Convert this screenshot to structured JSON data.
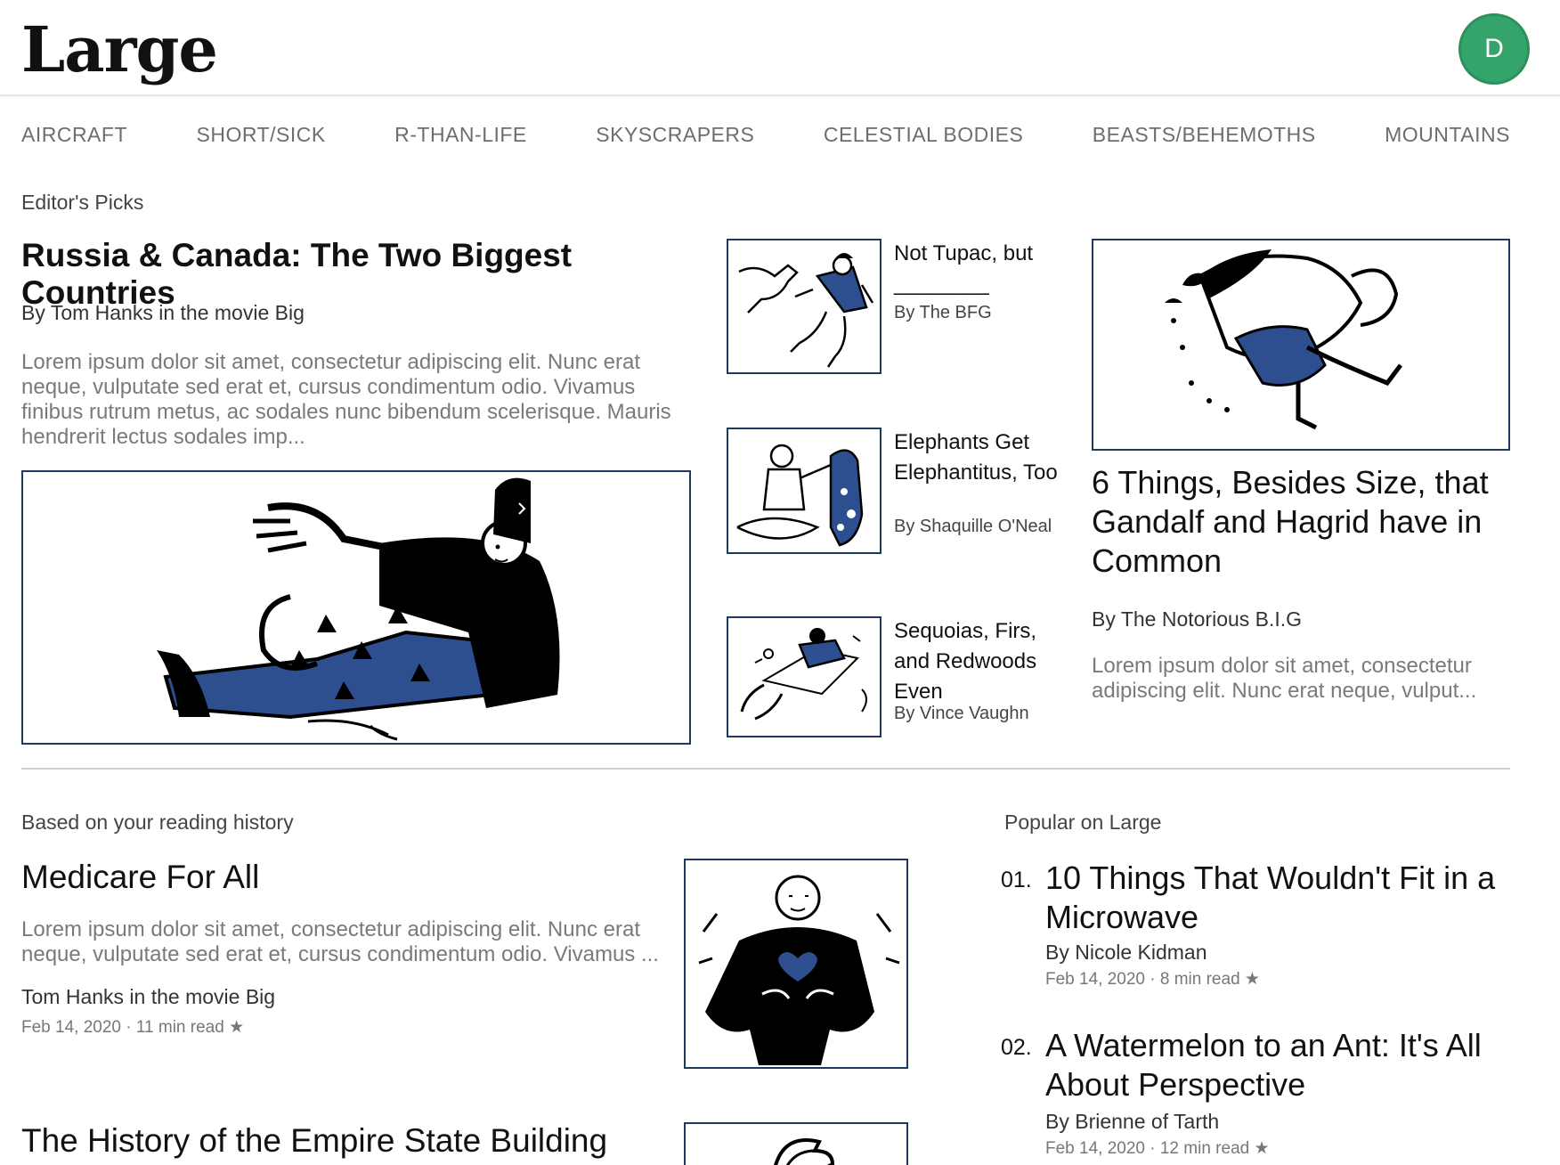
{
  "app": {
    "logo": "Large",
    "avatar_letter": "D"
  },
  "colors": {
    "accent": "#34a46a",
    "frame": "#1e3a5f",
    "illustration_blue": "#2d4f8f"
  },
  "nav": [
    "AIRCRAFT",
    "SHORT/SICK",
    "R-THAN-LIFE",
    "SKYSCRAPERS",
    "CELESTIAL BODIES",
    "BEASTS/BEHEMOTHS",
    "MOUNTAINS"
  ],
  "editors_picks": {
    "label": "Editor's Picks",
    "hero": {
      "title": "Russia & Canada: The Two Biggest Countries",
      "byline": "By Tom Hanks in the movie Big",
      "excerpt": "Lorem ipsum dolor sit amet, consectetur adipiscing elit. Nunc erat neque, vulputate sed erat et, cursus condimentum odio. Vivamus finibus rutrum metus, ac sodales nunc bibendum scelerisque. Mauris hendrerit lectus sodales imp...",
      "image_icon": "reclining-person-illustration"
    },
    "side": [
      {
        "title": "Not Tupac, but ________",
        "byline": "By The BFG",
        "image_icon": "dog-chase-illustration"
      },
      {
        "title": "Elephants Get Elephantitus, Too",
        "byline": "By Shaquille O'Neal",
        "image_icon": "person-with-dog-illustration"
      },
      {
        "title": "Sequoias, Firs, and Redwoods Even",
        "byline": "By Vince Vaughn",
        "image_icon": "falling-person-illustration"
      }
    ],
    "feature": {
      "title": "6 Things, Besides Size, that Gandalf and Hagrid have in Common",
      "byline": "By The Notorious B.I.G",
      "excerpt": "Lorem ipsum dolor sit amet, consectetur adipiscing elit. Nunc erat neque, vulput...",
      "image_icon": "giant-coffee-cup-illustration"
    }
  },
  "reading_history": {
    "label": "Based on your reading history",
    "items": [
      {
        "title": "Medicare For All",
        "excerpt": "Lorem ipsum dolor sit amet, consectetur adipiscing elit. Nunc erat neque, vulputate sed erat et, cursus condimentum odio. Vivamus ...",
        "author": "Tom Hanks in the movie Big",
        "meta": "Feb 14, 2020 · 11 min read",
        "image_icon": "person-heart-illustration"
      },
      {
        "title": "The History of the Empire State Building",
        "image_icon": "building-illustration"
      }
    ]
  },
  "popular": {
    "label": "Popular on Large",
    "items": [
      {
        "num": "01.",
        "title": "10 Things That Wouldn't Fit in a Microwave",
        "byline": "By Nicole Kidman",
        "meta": "Feb 14, 2020 · 8 min read"
      },
      {
        "num": "02.",
        "title": "A Watermelon to an Ant: It's All About Perspective",
        "byline": "By Brienne of Tarth",
        "meta": "Feb 14, 2020 · 12 min read"
      }
    ]
  },
  "star_glyph": "★"
}
